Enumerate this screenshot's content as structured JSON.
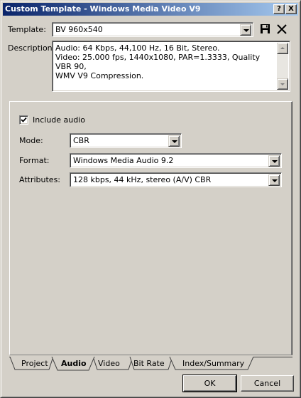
{
  "window": {
    "title": "Custom Template - Windows Media Video V9",
    "help_button": "?",
    "close_button": "X"
  },
  "template": {
    "label": "Template:",
    "value": "BV 960x540"
  },
  "description": {
    "label": "Description:",
    "text": "Audio: 64 Kbps, 44,100 Hz, 16 Bit, Stereo.\nVideo: 25.000 fps, 1440x1080, PAR=1.3333, Quality VBR 90,\nWMV V9 Compression."
  },
  "audio": {
    "include_audio_label": "Include audio",
    "include_audio_checked": true,
    "mode_label": "Mode:",
    "mode_value": "CBR",
    "format_label": "Format:",
    "format_value": "Windows Media Audio 9.2",
    "attributes_label": "Attributes:",
    "attributes_value": "128 kbps, 44 kHz, stereo (A/V) CBR"
  },
  "tabs": [
    {
      "label": "Project",
      "active": false
    },
    {
      "label": "Audio",
      "active": true
    },
    {
      "label": "Video",
      "active": false
    },
    {
      "label": "Bit Rate",
      "active": false
    },
    {
      "label": "Index/Summary",
      "active": false
    }
  ],
  "buttons": {
    "ok": "OK",
    "cancel": "Cancel"
  },
  "icons": {
    "save": "floppy-disk-icon",
    "delete": "delete-x-icon"
  },
  "colors": {
    "title_gradient_start": "#0a246a",
    "title_gradient_end": "#a6caf0",
    "face": "#d4d0c8"
  }
}
